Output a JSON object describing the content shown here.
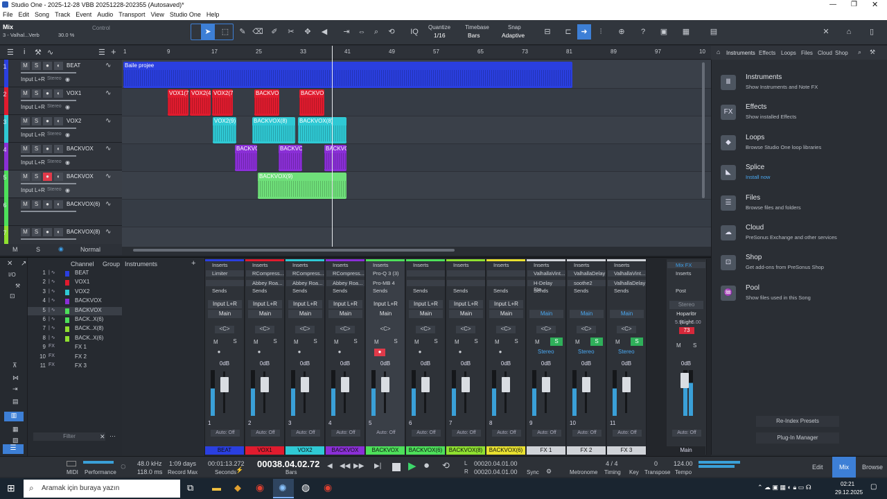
{
  "window": {
    "title": "Studio One - 2025-12-28 VBB 20251228-202355 (Autosaved)*"
  },
  "menu": [
    "File",
    "Edit",
    "Song",
    "Track",
    "Event",
    "Audio",
    "Transport",
    "View",
    "Studio One",
    "Help"
  ],
  "toolbar": {
    "mix_label": "Mix",
    "track_label": "3 - Valhal...Verb",
    "percent": "30.0 %",
    "control_label": "Control",
    "quantize_label": "Quantize",
    "quantize_value": "1/16",
    "timebase_label": "Timebase",
    "timebase_value": "Bars",
    "snap_label": "Snap",
    "snap_value": "Adaptive"
  },
  "ruler": {
    "marks": [
      "1",
      "9",
      "17",
      "25",
      "33",
      "41",
      "49",
      "57",
      "65",
      "73",
      "81",
      "89",
      "97",
      "10"
    ]
  },
  "tracks": [
    {
      "num": "1",
      "name": "BEAT",
      "input": "Input L+R",
      "mode": "Stereo",
      "color": "#2a3fe0"
    },
    {
      "num": "2",
      "name": "VOX1",
      "input": "Input L+R",
      "mode": "Stereo",
      "color": "#e01b2e"
    },
    {
      "num": "3",
      "name": "VOX2",
      "input": "Input L+R",
      "mode": "Stereo",
      "color": "#2fc9d4"
    },
    {
      "num": "4",
      "name": "BACKVOX",
      "input": "Input L+R",
      "mode": "Stereo",
      "color": "#8a2fd6"
    },
    {
      "num": "5",
      "name": "BACKVOX",
      "input": "Input L+R",
      "mode": "Stereo",
      "color": "#4de05a"
    },
    {
      "num": "6",
      "name": "BACKVOX(6)",
      "input": "",
      "mode": "",
      "color": "#4de05a"
    },
    {
      "num": "7",
      "name": "BACKVOX(8)",
      "input": "",
      "mode": "",
      "color": "#8fe030"
    }
  ],
  "track_footer": {
    "m": "M",
    "s": "S",
    "mode": "Normal"
  },
  "clips": {
    "beat": "Baile projee",
    "vox1": [
      "VOX1(7)",
      "VOX2(4)",
      "VOX2(7)",
      "BACKVO",
      "BACKVO"
    ],
    "vox2": [
      "VOX2(9)",
      "BACKVOX(8)",
      "BACKVOX(8)"
    ],
    "back4": [
      "BACKVO",
      "BACKVO",
      "BACKVO"
    ],
    "back5": [
      "BACKVOX(9)"
    ]
  },
  "browser": {
    "tabs": [
      "Instruments",
      "Effects",
      "Loops",
      "Files",
      "Cloud",
      "Shop"
    ],
    "items": [
      {
        "title": "Instruments",
        "sub": "Show Instruments and Note FX",
        "icon": "Ⅲ"
      },
      {
        "title": "Effects",
        "sub": "Show installed Effects",
        "icon": "FX"
      },
      {
        "title": "Loops",
        "sub": "Browse Studio One loop libraries",
        "icon": "◆"
      },
      {
        "title": "Splice",
        "sub": "Install now",
        "icon": "◣"
      },
      {
        "title": "Files",
        "sub": "Browse files and folders",
        "icon": "☰"
      },
      {
        "title": "Cloud",
        "sub": "PreSonus Exchange and other services",
        "icon": "☁"
      },
      {
        "title": "Shop",
        "sub": "Get add-ons from PreSonus Shop",
        "icon": "⊡"
      },
      {
        "title": "Pool",
        "sub": "Show files used in this Song",
        "icon": "♒"
      }
    ],
    "reindex": "Re-Index Presets",
    "plugin": "Plug-In Manager"
  },
  "channel_list": {
    "header_channel": "Channel",
    "header_group": "Group",
    "header_instruments": "Instruments",
    "filter": "Filter",
    "rows": [
      {
        "n": "1",
        "name": "BEAT",
        "color": "#2a3fe0"
      },
      {
        "n": "2",
        "name": "VOX1",
        "color": "#e01b2e"
      },
      {
        "n": "3",
        "name": "VOX2",
        "color": "#2fc9d4"
      },
      {
        "n": "4",
        "name": "BACKVOX",
        "color": "#8a2fd6"
      },
      {
        "n": "5",
        "name": "BACKVOX",
        "color": "#4de05a"
      },
      {
        "n": "6",
        "name": "BACK..X(6)",
        "color": "#4de05a"
      },
      {
        "n": "7",
        "name": "BACK..X(8)",
        "color": "#8fe030"
      },
      {
        "n": "8",
        "name": "BACK..X(6)",
        "color": "#8fe030"
      },
      {
        "n": "9",
        "name": "FX 1",
        "color": ""
      },
      {
        "n": "10",
        "name": "FX 2",
        "color": ""
      },
      {
        "n": "11",
        "name": "FX 3",
        "color": ""
      }
    ]
  },
  "strips": [
    {
      "num": "1",
      "label": "BEAT",
      "color": "#2a3fe0",
      "input": "Input L+R",
      "out": "Main",
      "ins1": "Limiter",
      "ins2": "",
      "db": "0dB"
    },
    {
      "num": "2",
      "label": "VOX1",
      "color": "#e01b2e",
      "input": "Input L+R",
      "out": "Main",
      "ins1": "RCompress...",
      "ins2": "Abbey Roa...",
      "db": "0dB"
    },
    {
      "num": "3",
      "label": "VOX2",
      "color": "#2fc9d4",
      "input": "Input L+R",
      "out": "Main",
      "ins1": "RCompress...",
      "ins2": "Abbey Roa...",
      "db": "0dB"
    },
    {
      "num": "4",
      "label": "BACKVOX",
      "color": "#8a2fd6",
      "input": "Input L+R",
      "out": "Main",
      "ins1": "RCompress...",
      "ins2": "Abbey Roa...",
      "db": "0dB"
    },
    {
      "num": "5",
      "label": "BACKVOX",
      "color": "#4de05a",
      "input": "Input L+R",
      "out": "Main",
      "ins1": "Pro-Q 3 (3)",
      "ins2": "Pro-MB 4",
      "db": "0dB"
    },
    {
      "num": "6",
      "label": "BACKVOX(6)",
      "color": "#4de05a",
      "input": "Input L+R",
      "out": "Main",
      "ins1": "",
      "ins2": "",
      "db": "0dB"
    },
    {
      "num": "7",
      "label": "BACKVOX(8)",
      "color": "#8fe030",
      "input": "Input L+R",
      "out": "Main",
      "ins1": "",
      "ins2": "",
      "db": "0dB"
    },
    {
      "num": "8",
      "label": "BACKVOX(6)",
      "color": "#e8e030",
      "input": "Input L+R",
      "out": "Main",
      "ins1": "",
      "ins2": "",
      "db": "0dB"
    },
    {
      "num": "9",
      "label": "FX 1",
      "color": "#d0d3d8",
      "input": "",
      "out": "Main",
      "ins1": "ValhallaVint...",
      "ins2": "H-Delay Ste...",
      "db": "0dB"
    },
    {
      "num": "10",
      "label": "FX 2",
      "color": "#d0d3d8",
      "input": "",
      "out": "Main",
      "ins1": "ValhallaDelay",
      "ins2": "soothe2",
      "db": "0dB"
    },
    {
      "num": "11",
      "label": "FX 3",
      "color": "#d0d3d8",
      "input": "",
      "out": "Main",
      "ins1": "ValhallaVint...",
      "ins2": "ValhallaDelay",
      "db": "0dB"
    }
  ],
  "main_strip": {
    "label": "Main",
    "mixfx": "Mix FX",
    "inserts": "Inserts",
    "post": "Post",
    "stereo": "Stereo",
    "output": "Hoparlör (Light",
    "peak": "73",
    "db": "0dB",
    "left": "5.94",
    "right": "6.00"
  },
  "transport": {
    "midi": "MIDI",
    "performance": "Performance",
    "sr": "48.0 kHz",
    "latency": "118.0 ms",
    "rec_days": "1:09 days",
    "rec_max": "Record Max",
    "seconds": "00:01:13.272",
    "seconds_label": "Seconds",
    "bars": "00038.04.02.72",
    "bars_label": "Bars",
    "l": "00020.04.01.00",
    "r": "00020.04.01.00",
    "sync": "Sync",
    "metronome": "Metronome",
    "timing": "4 / 4",
    "timing_label": "Timing",
    "key_label": "Key",
    "transpose": "0",
    "transpose_label": "Transpose",
    "tempo": "124.00",
    "tempo_label": "Tempo",
    "edit": "Edit",
    "mix": "Mix",
    "browse": "Browse"
  },
  "taskbar": {
    "search": "Aramak için buraya yazın",
    "time": "02:21",
    "date": "29.12.2025"
  }
}
